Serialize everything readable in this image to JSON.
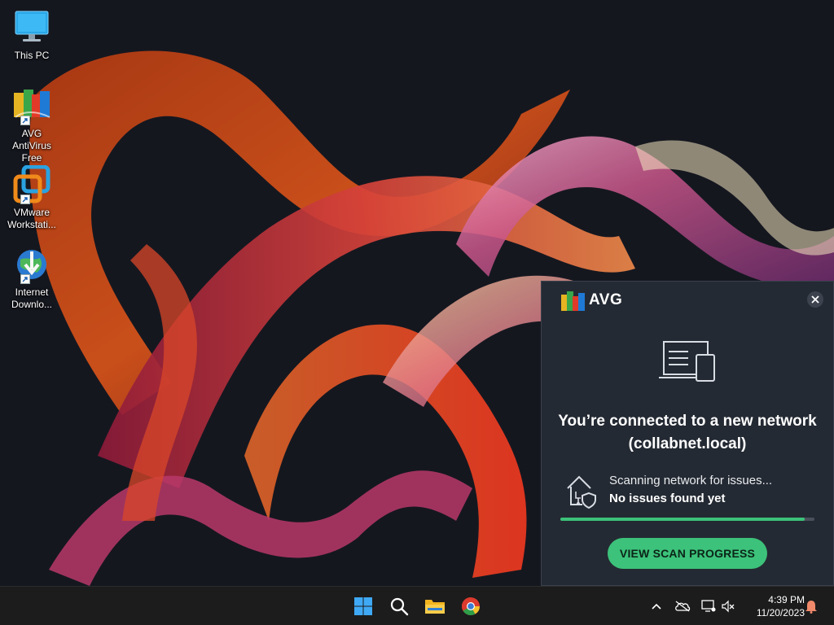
{
  "desktop": {
    "icons": [
      {
        "label": "This PC"
      },
      {
        "label": "AVG AntiVirus Free"
      },
      {
        "label": "VMware Workstati..."
      },
      {
        "label": "Internet Downlo..."
      }
    ]
  },
  "avg_popup": {
    "brand": "AVG",
    "title": "You’re connected to a new network (collabnet.local)",
    "scan_status": "Scanning network for issues...",
    "scan_result": "No issues found yet",
    "progress": 0.96,
    "button_label": "VIEW SCAN PROGRESS",
    "accent_color": "#3cc27a",
    "background_color": "#242a33"
  },
  "taskbar": {
    "apps": [
      {
        "icon": "windows-start-icon"
      },
      {
        "icon": "search-icon"
      },
      {
        "icon": "file-explorer-icon"
      },
      {
        "icon": "chrome-icon"
      }
    ],
    "tray": {
      "icons": [
        "chevron-up-icon",
        "cloud-offline-icon",
        "network-icon",
        "volume-muted-icon",
        "notification-bell-icon"
      ],
      "time": "4:39 PM",
      "date": "11/20/2023"
    }
  }
}
